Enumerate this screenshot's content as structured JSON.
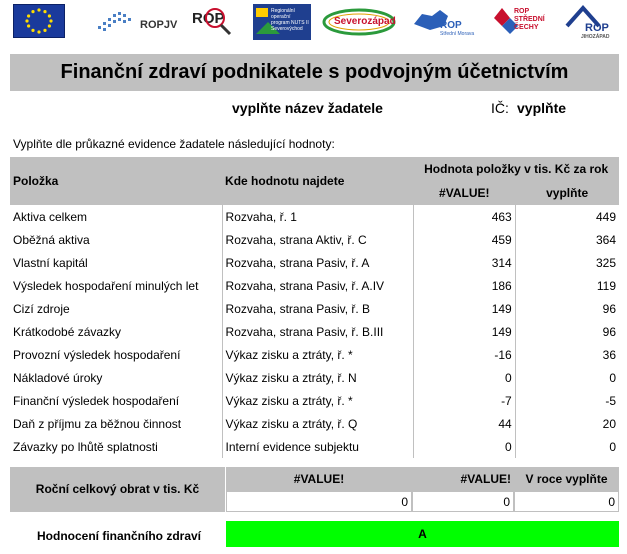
{
  "logos": {
    "ropjv": "ROPJV",
    "rop": "ROP",
    "regional_program": "Regionální operační program NUTS II Severovýchod",
    "severozapad": "Severozápad",
    "rop_sm": "ROP",
    "rop_sm_sub": "Střední Morava",
    "rop_sc": "ROP STŘEDNÍ ČECHY",
    "rop_jz": "ROP",
    "rop_jz_sub": "JIHOZÁPAD"
  },
  "title": "Finanční zdraví podnikatele s podvojným účetnictvím",
  "applicant": {
    "name_value": "vyplňte název žadatele",
    "ic_label": "IČ:",
    "ic_value": "vyplňte"
  },
  "instruction": "Vyplňte dle průkazné evidence žadatele následující hodnoty:",
  "table": {
    "col_item": "Položka",
    "col_where": "Kde hodnotu najdete",
    "col_value_group": "Hodnota položky v tis. Kč za rok",
    "col_year1": "#VALUE!",
    "col_year2": "vyplňte",
    "rows": [
      {
        "item": "Aktiva celkem",
        "where": "Rozvaha, ř. 1",
        "v1": "463",
        "v2": "449"
      },
      {
        "item": "Oběžná aktiva",
        "where": "Rozvaha, strana Aktiv, ř. C",
        "v1": "459",
        "v2": "364"
      },
      {
        "item": "Vlastní kapitál",
        "where": "Rozvaha, strana Pasiv, ř. A",
        "v1": "314",
        "v2": "325"
      },
      {
        "item": "Výsledek hospodaření minulých let",
        "where": "Rozvaha, strana Pasiv, ř. A.IV",
        "v1": "186",
        "v2": "119"
      },
      {
        "item": "Cizí zdroje",
        "where": "Rozvaha, strana Pasiv, ř. B",
        "v1": "149",
        "v2": "96"
      },
      {
        "item": "Krátkodobé závazky",
        "where": "Rozvaha, strana Pasiv, ř. B.III",
        "v1": "149",
        "v2": "96"
      },
      {
        "item": "Provozní výsledek hospodaření",
        "where": "Výkaz zisku a ztráty, ř. *",
        "v1": "-16",
        "v2": "36"
      },
      {
        "item": "Nákladové úroky",
        "where": "Výkaz zisku a ztráty, ř. N",
        "v1": "0",
        "v2": "0"
      },
      {
        "item": "Finanční výsledek hospodaření",
        "where": "Výkaz zisku a ztráty, ř. *",
        "v1": "-7",
        "v2": "-5"
      },
      {
        "item": "Daň z příjmu za běžnou činnost",
        "where": "Výkaz zisku a ztráty, ř. Q",
        "v1": "44",
        "v2": "20"
      },
      {
        "item": "Závazky po lhůtě splatnosti",
        "where": "Interní evidence subjektu",
        "v1": "0",
        "v2": "0"
      }
    ]
  },
  "turnover": {
    "label": "Roční celkový obrat v tis. Kč",
    "h1": "#VALUE!",
    "h2": "#VALUE!",
    "h3": "V roce vyplňte",
    "v1": "0",
    "v2": "0",
    "v3": "0"
  },
  "rating": {
    "label": "Hodnocení finančního zdraví",
    "value": "A"
  },
  "colors": {
    "header_gray": "#c0c0c0",
    "rating_green": "#00ff00",
    "eu_blue": "#1a3a9c",
    "eu_star": "#ffdd00"
  }
}
